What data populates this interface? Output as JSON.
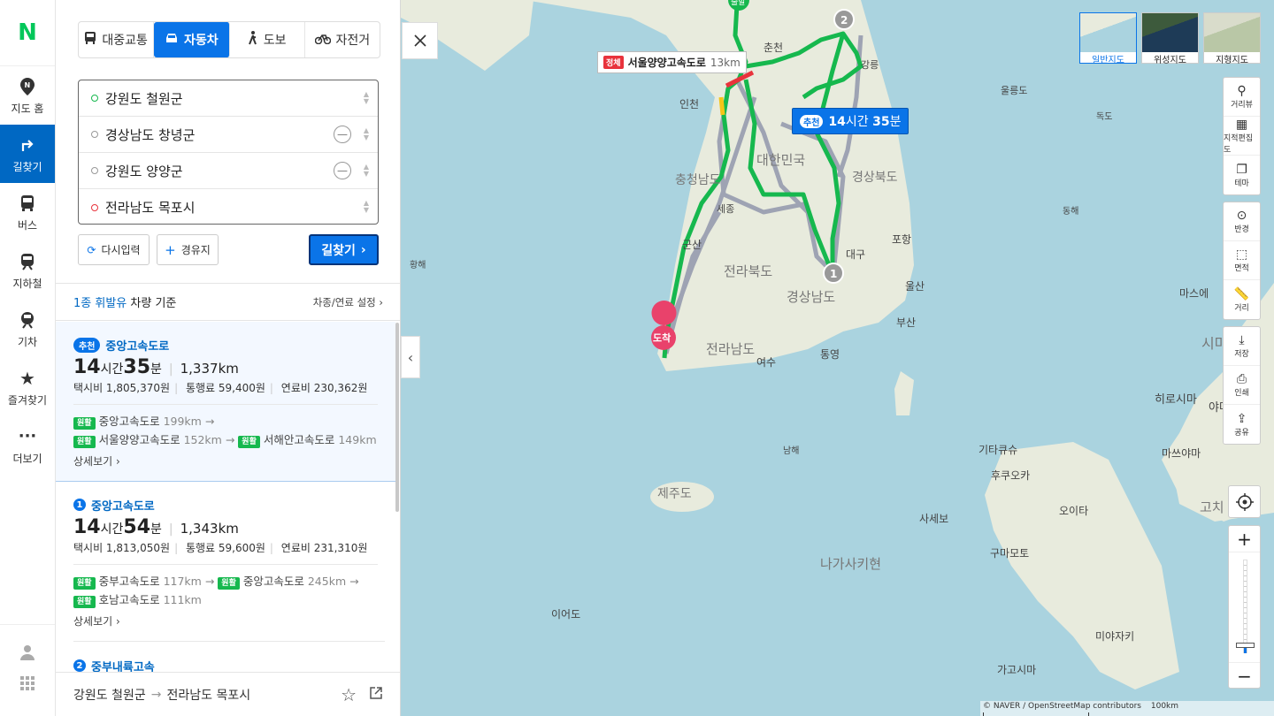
{
  "rail": {
    "logo": "N",
    "items": [
      {
        "label": "지도 홈"
      },
      {
        "label": "길찾기"
      },
      {
        "label": "버스"
      },
      {
        "label": "지하철"
      },
      {
        "label": "기차"
      },
      {
        "label": "즐겨찾기"
      },
      {
        "label": "더보기"
      }
    ]
  },
  "modes": [
    "대중교통",
    "자동차",
    "도보",
    "자전거"
  ],
  "stops": [
    "강원도 철원군",
    "경상남도 창녕군",
    "강원도 양양군",
    "전라남도 목포시"
  ],
  "actions": {
    "reset": "다시입력",
    "waypoint": "경유지",
    "search": "길찾기"
  },
  "basis": {
    "fuel": "1종 휘발유",
    "label": "차량 기준",
    "settings": "차종/연료 설정"
  },
  "routes": [
    {
      "badge": "추천",
      "name": "중앙고속도로",
      "hours": "14",
      "h_unit": "시간",
      "mins": "35",
      "m_unit": "분",
      "distance": "1,337km",
      "taxi": "택시비 1,805,370원",
      "toll": "통행료 59,400원",
      "fuel": "연료비 230,362원",
      "segments": [
        {
          "tag": "원활",
          "road": "중앙고속도로",
          "km": "199km"
        },
        {
          "tag": "원활",
          "road": "서울양양고속도로",
          "km": "152km"
        },
        {
          "tag": "원활",
          "road": "서해안고속도로",
          "km": "149km"
        }
      ],
      "detail": "상세보기"
    },
    {
      "badge": "1",
      "name": "중앙고속도로",
      "hours": "14",
      "h_unit": "시간",
      "mins": "54",
      "m_unit": "분",
      "distance": "1,343km",
      "taxi": "택시비 1,813,050원",
      "toll": "통행료 59,600원",
      "fuel": "연료비 231,310원",
      "segments": [
        {
          "tag": "원활",
          "road": "중부고속도로",
          "km": "117km"
        },
        {
          "tag": "원활",
          "road": "중앙고속도로",
          "km": "245km"
        },
        {
          "tag": "원활",
          "road": "호남고속도로",
          "km": "111km"
        }
      ],
      "detail": "상세보기"
    },
    {
      "badge": "2",
      "name": "중부내륙고속"
    }
  ],
  "bottom": {
    "from": "강원도 철원군",
    "to": "전라남도 목포시"
  },
  "map": {
    "types": [
      {
        "label": "일반지도"
      },
      {
        "label": "위성지도"
      },
      {
        "label": "지형지도"
      }
    ],
    "tools1": [
      "거리뷰",
      "지적편집도",
      "테마"
    ],
    "tools2": [
      "반경",
      "면적",
      "거리"
    ],
    "tools3": [
      "저장",
      "인쇄",
      "공유"
    ],
    "congestion": {
      "tag": "정체",
      "road": "서울양양고속도로",
      "km": "13km"
    },
    "time_label": {
      "badge": "추천",
      "h": "14",
      "hu": "시간",
      "m": "35",
      "mu": "분"
    },
    "start_label": "출발",
    "end_label": "도착",
    "wp1": "1",
    "wp2": "2",
    "labels": [
      "춘천",
      "강릉",
      "울릉도",
      "독도",
      "인천",
      "대한민국",
      "충청남도",
      "세종",
      "경상북도",
      "포항",
      "대구",
      "울산",
      "전라북도",
      "군산",
      "경상남도",
      "부산",
      "전라남도",
      "여수",
      "통영",
      "제주도",
      "황해",
      "남해",
      "동해",
      "마스에",
      "시마네",
      "히로시마",
      "야마구치",
      "기타큐슈",
      "후쿠오카",
      "마쓰야마",
      "오이타",
      "고치",
      "사세보",
      "구마모토",
      "나가사키현",
      "미야자키",
      "가고시마",
      "이어도"
    ],
    "copyright": "© NAVER / OpenStreetMap contributors",
    "scale": "100km"
  },
  "colors": {
    "accent": "#0a74e8",
    "go_border": "#05347a",
    "route": "#16b84e",
    "alt_route": "#9ea3b3",
    "end": "#e9426b",
    "congestion": "#e8333c"
  }
}
